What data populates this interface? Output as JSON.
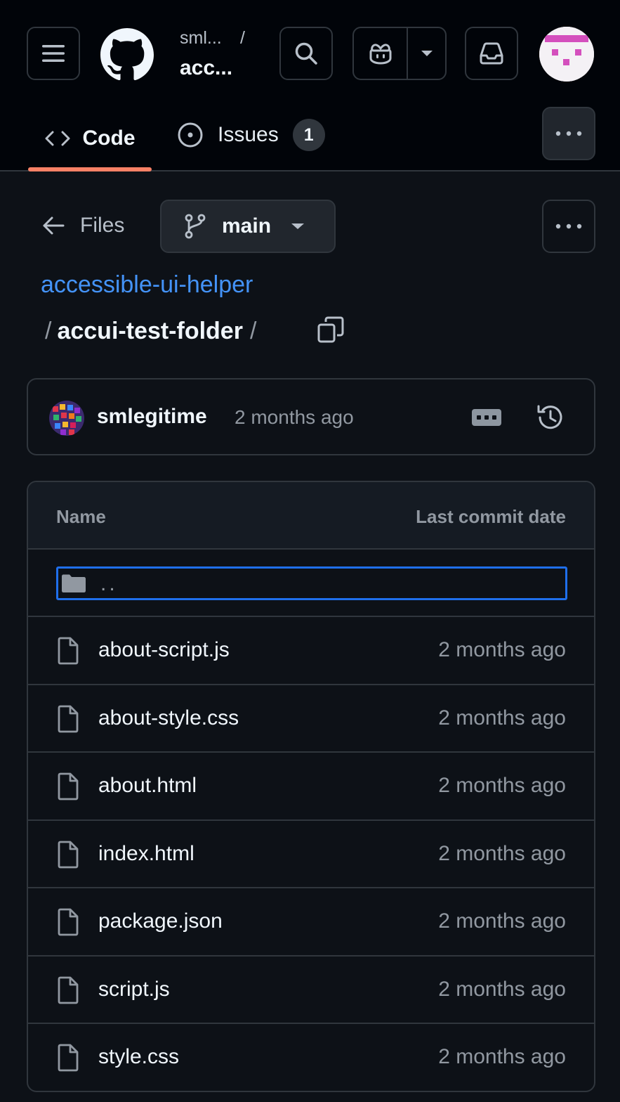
{
  "header": {
    "breadcrumb_owner": "sml...",
    "breadcrumb_separator": "/",
    "breadcrumb_repo": "acc...",
    "icons": {
      "menu": "hamburger-icon",
      "logo": "github-mark-icon",
      "search": "search-icon",
      "copilot": "copilot-icon",
      "caret": "triangle-down-icon",
      "inbox": "inbox-icon"
    },
    "colors": {
      "background": "#010409",
      "border": "#30363d",
      "tab_underline": "#f78166"
    }
  },
  "tabs": [
    {
      "label": "Code",
      "icon": "code-icon",
      "selected": true
    },
    {
      "label": "Issues",
      "icon": "issue-opened-icon",
      "count": "1",
      "selected": false
    }
  ],
  "files_bar": {
    "back_label": "Files",
    "branch_label": "main"
  },
  "path": {
    "repo": "accessible-ui-helper",
    "separator": "/",
    "folder": "accui-test-folder",
    "trailing_separator": "/",
    "link_color": "#4493f8"
  },
  "commit": {
    "author": "smlegitime",
    "time": "2 months ago"
  },
  "table": {
    "header_name": "Name",
    "header_date": "Last commit date",
    "parent_label": "..",
    "rows": [
      {
        "name": "about-script.js",
        "date": "2 months ago"
      },
      {
        "name": "about-style.css",
        "date": "2 months ago"
      },
      {
        "name": "about.html",
        "date": "2 months ago"
      },
      {
        "name": "index.html",
        "date": "2 months ago"
      },
      {
        "name": "package.json",
        "date": "2 months ago"
      },
      {
        "name": "script.js",
        "date": "2 months ago"
      },
      {
        "name": "style.css",
        "date": "2 months ago"
      }
    ],
    "focus_color": "#1f6feb"
  }
}
